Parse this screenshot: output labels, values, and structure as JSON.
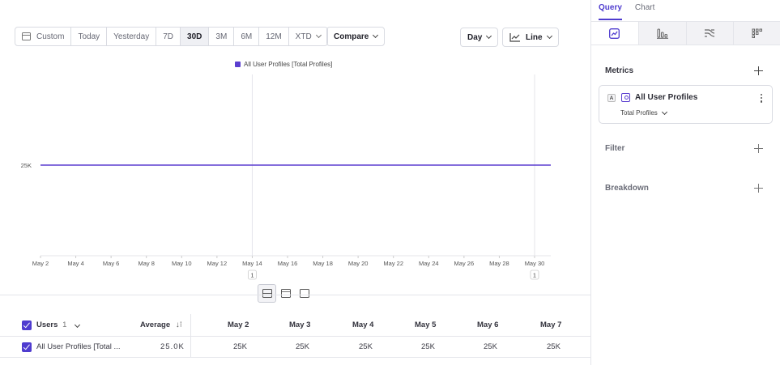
{
  "toolbar": {
    "date_ranges": [
      {
        "label": "Custom",
        "active": false
      },
      {
        "label": "Today",
        "active": false
      },
      {
        "label": "Yesterday",
        "active": false
      },
      {
        "label": "7D",
        "active": false
      },
      {
        "label": "30D",
        "active": true
      },
      {
        "label": "3M",
        "active": false
      },
      {
        "label": "6M",
        "active": false
      },
      {
        "label": "12M",
        "active": false
      },
      {
        "label": "XTD",
        "active": false
      }
    ],
    "compare_label": "Compare",
    "interval_label": "Day",
    "chart_type_label": "Line"
  },
  "chart_data": {
    "type": "line",
    "legend_placement": "top-center",
    "series": [
      {
        "name": "All User Profiles [Total Profiles]",
        "color": "#5b3fd0",
        "values": [
          25000,
          25000
        ]
      }
    ],
    "x_tick_labels": [
      "May 2",
      "May 4",
      "May 6",
      "May 8",
      "May 10",
      "May 12",
      "May 14",
      "May 16",
      "May 18",
      "May 20",
      "May 22",
      "May 24",
      "May 26",
      "May 28",
      "May 30"
    ],
    "y_tick_labels": [
      "25K"
    ],
    "ylim": [
      0,
      50000
    ],
    "annotations": [
      {
        "at": "May 14",
        "label": "1"
      },
      {
        "at": "May 30",
        "label": "1"
      }
    ],
    "grid": false
  },
  "table": {
    "header": {
      "group_label": "Users",
      "group_count": "1",
      "average_label": "Average",
      "dates": [
        "May 2",
        "May 3",
        "May 4",
        "May 5",
        "May 6",
        "May 7"
      ]
    },
    "rows": [
      {
        "label": "All User Profiles [Total ...",
        "average": "25.0K",
        "values": [
          "25K",
          "25K",
          "25K",
          "25K",
          "25K",
          "25K"
        ]
      }
    ]
  },
  "panel": {
    "tabs": [
      {
        "label": "Query",
        "active": true
      },
      {
        "label": "Chart",
        "active": false
      }
    ],
    "view_tabs": [
      "insights-icon",
      "funnels-icon",
      "flows-icon",
      "retention-icon"
    ],
    "metrics": {
      "title": "Metrics",
      "items": [
        {
          "letter": "A",
          "name": "All User Profiles",
          "measure": "Total Profiles"
        }
      ]
    },
    "filter_title": "Filter",
    "breakdown_title": "Breakdown"
  },
  "colors": {
    "accent": "#4f3ccf",
    "series": "#5b3fd0"
  }
}
